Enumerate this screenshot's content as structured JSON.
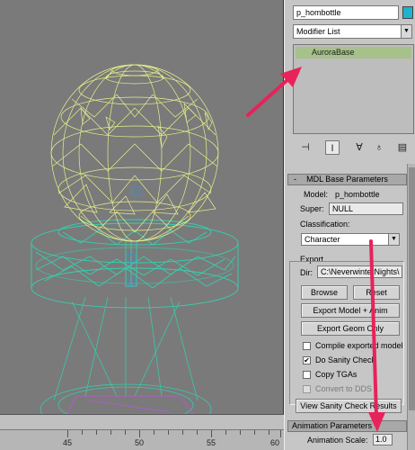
{
  "object": {
    "name": "p_hombottle"
  },
  "modifier_list": {
    "label": "Modifier List"
  },
  "stack": {
    "items": [
      {
        "label": "AuroraBase"
      }
    ]
  },
  "mdl_base": {
    "title": "MDL Base Parameters",
    "model_label": "Model:",
    "model_value": "p_hombottle",
    "super_label": "Super:",
    "super_value": "NULL",
    "classification_label": "Classification:",
    "classification_value": "Character",
    "export_label": "Export",
    "dir_label": "Dir:",
    "dir_value": "C:\\NeverwinterNights\\",
    "browse": "Browse",
    "reset": "Reset",
    "export_model_anim": "Export Model + Anim",
    "export_geom_only": "Export Geom Only",
    "options": [
      {
        "label": "Compile exported model",
        "checked": false,
        "disabled": false
      },
      {
        "label": "Do Sanity Check",
        "checked": true,
        "disabled": false
      },
      {
        "label": "Copy TGAs",
        "checked": false,
        "disabled": false
      },
      {
        "label": "Convert to DDS",
        "checked": false,
        "disabled": true
      }
    ],
    "view_sanity": "View Sanity Check Results"
  },
  "anim_params": {
    "title": "Animation Parameters",
    "scale_label": "Animation Scale:",
    "scale_value": "1.0"
  },
  "timeline": {
    "ticks": [
      "45",
      "50",
      "55",
      "60"
    ]
  },
  "colors": {
    "wire_bottle": "#e6f08a",
    "wire_base": "#34d1b0",
    "annotation": "#e8225a",
    "stack_highlight": "#a6c18a"
  }
}
